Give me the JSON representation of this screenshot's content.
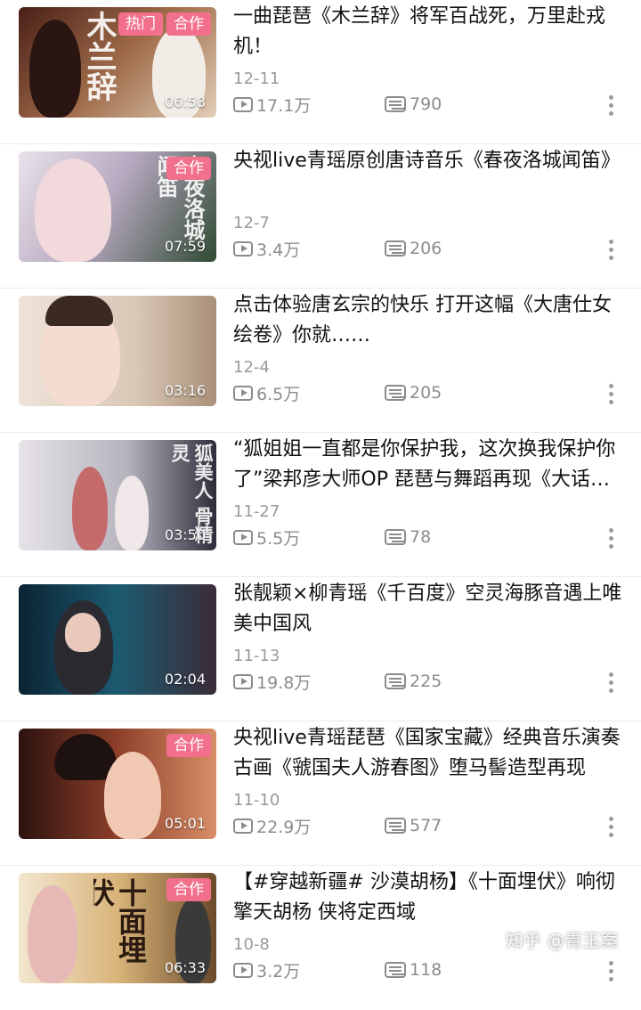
{
  "videos": [
    {
      "title": "一曲琵琶《木兰辞》将军百战死，万里赴戎机！",
      "date": "12-11",
      "views": "17.1万",
      "danmu": "790",
      "duration": "06:58",
      "badges": [
        "热门",
        "合作"
      ],
      "art": "木兰辞",
      "colors": [
        "#5a2a20",
        "#c9a27a",
        "#e8d6c0"
      ]
    },
    {
      "title": "央视live青瑶原创唐诗音乐《春夜洛城闻笛》",
      "date": "12-7",
      "views": "3.4万",
      "danmu": "206",
      "duration": "07:59",
      "badges": [
        "合作"
      ],
      "art": "春夜洛城闻笛",
      "colors": [
        "#2f4a33",
        "#9a8fa8",
        "#e9e2ea"
      ]
    },
    {
      "title": "点击体验唐玄宗的快乐  打开这幅《大唐仕女绘卷》你就……",
      "date": "12-4",
      "views": "6.5万",
      "danmu": "205",
      "duration": "03:16",
      "badges": [],
      "art": "",
      "colors": [
        "#6d5a4a",
        "#d9c7b5",
        "#efe3d8"
      ]
    },
    {
      "title": "“狐姐姐一直都是你保护我，这次换我保护你了”梁邦彦大师OP  琵琶与舞蹈再现《大话西游之大圣娶亲》名场面",
      "date": "11-27",
      "views": "5.5万",
      "danmu": "78",
      "duration": "03:50",
      "badges": [],
      "art": "狐美人 骨精灵",
      "colors": [
        "#3a3a48",
        "#a9a9b5",
        "#e6e3e8"
      ]
    },
    {
      "title": "张靓颖×柳青瑶《千百度》空灵海豚音遇上唯美中国风",
      "date": "11-13",
      "views": "19.8万",
      "danmu": "225",
      "duration": "02:04",
      "badges": [],
      "art": "",
      "colors": [
        "#0d2a3a",
        "#1e5f75",
        "#4b3a44"
      ]
    },
    {
      "title": "央视live青瑶琵琶《国家宝藏》经典音乐演奏    古画《虢国夫人游春图》堕马髻造型再现",
      "date": "11-10",
      "views": "22.9万",
      "danmu": "577",
      "duration": "05:01",
      "badges": [
        "合作"
      ],
      "art": "",
      "colors": [
        "#3a1812",
        "#c0573a",
        "#e7b190"
      ]
    },
    {
      "title": "【#穿越新疆#  沙漠胡杨】《十面埋伏》响彻擎天胡杨  侠将定西域",
      "date": "10-8",
      "views": "3.2万",
      "danmu": "118",
      "duration": "06:33",
      "badges": [
        "合作"
      ],
      "art": "十面埋伏",
      "colors": [
        "#6b4a2a",
        "#d9b47a",
        "#f2e6cf"
      ]
    }
  ],
  "watermark": "知乎 @青玉案"
}
